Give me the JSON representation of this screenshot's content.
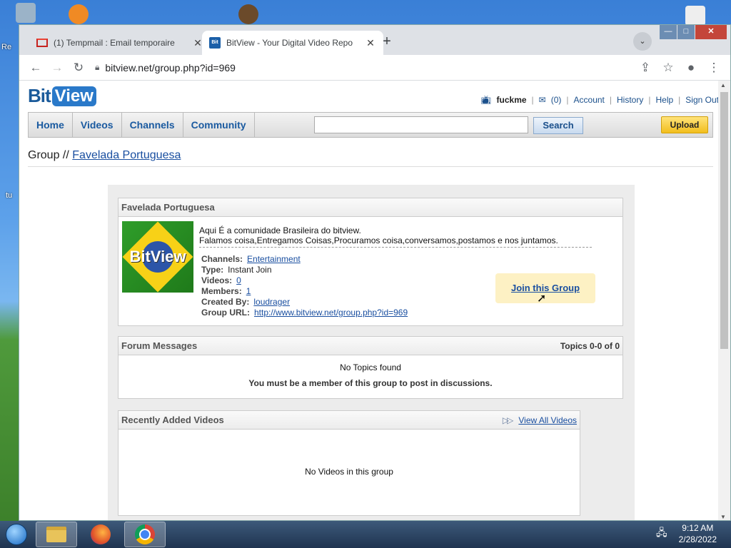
{
  "desktop": {
    "left_labels": [
      "Re",
      "tu"
    ]
  },
  "browser": {
    "tabs": [
      {
        "title": "(1) Tempmail : Email temporaire",
        "icon": "gmail-icon",
        "active": false
      },
      {
        "title": "BitView - Your Digital Video Repo",
        "icon": "bitview-icon",
        "active": true
      }
    ],
    "new_tab": "+",
    "url": "bitview.net/group.php?id=969",
    "window_buttons": {
      "minimize": "—",
      "maximize": "□",
      "close": "✕"
    }
  },
  "site": {
    "logo_bit": "Bit",
    "logo_view": "View",
    "user": {
      "username": "fuckme",
      "inbox_count": "(0)",
      "links": [
        "Account",
        "History",
        "Help",
        "Sign Out"
      ]
    },
    "nav": [
      "Home",
      "Videos",
      "Channels",
      "Community"
    ],
    "search_button": "Search",
    "search_value": "",
    "upload_button": "Upload",
    "breadcrumb_prefix": "Group //",
    "breadcrumb_link": "Favelada Portuguesa"
  },
  "group": {
    "title": "Favelada Portuguesa",
    "description_line1": "Aqui É a comunidade Brasileira do bitview.",
    "description_line2": "Falamos coisa,Entregamos Coisas,Procuramos coisa,conversamos,postamos e nos juntamos.",
    "channels_label": "Channels:",
    "channels_value": "Entertainment",
    "type_label": "Type:",
    "type_value": "Instant Join",
    "videos_label": "Videos:",
    "videos_value": "0",
    "members_label": "Members:",
    "members_value": "1",
    "created_label": "Created By:",
    "created_value": "loudrager",
    "url_label": "Group URL:",
    "url_value": "http://www.bitview.net/group.php?id=969",
    "join_button": "Join this Group",
    "image_text": "BitView"
  },
  "forum": {
    "title": "Forum Messages",
    "topics": "Topics 0-0 of 0",
    "empty": "No Topics found",
    "notice": "You must be a member of this group to post in discussions."
  },
  "recent_videos": {
    "title": "Recently Added Videos",
    "view_all": "View All Videos",
    "empty": "No Videos in this group"
  },
  "taskbar": {
    "time": "9:12 AM",
    "date": "2/28/2022"
  }
}
